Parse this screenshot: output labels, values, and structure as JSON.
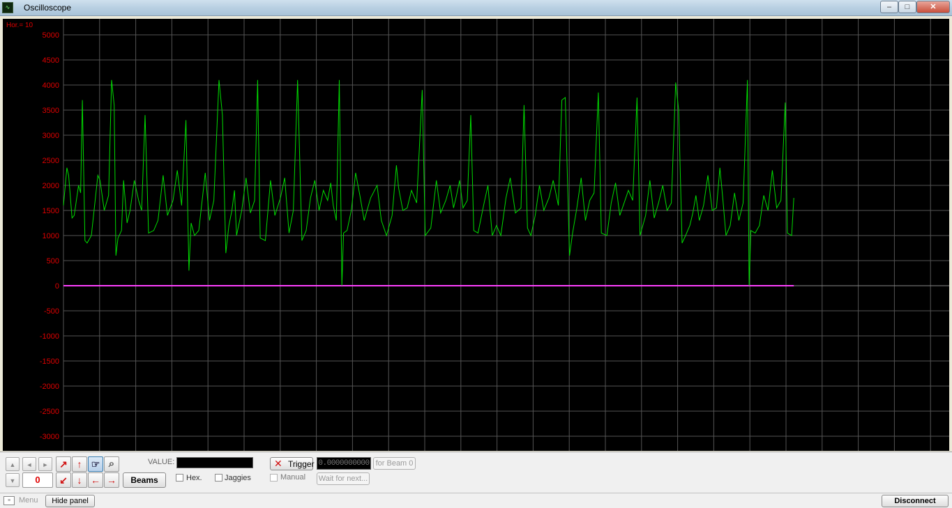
{
  "window": {
    "title": "Oscilloscope",
    "icon": "oscilloscope-app-icon",
    "min_glyph": "–",
    "max_glyph": "□",
    "close_glyph": "✕"
  },
  "scope": {
    "hor_label": "Hor.=  10",
    "background_color": "#000000",
    "grid_color": "#555555",
    "label_color": "#e00000",
    "trace_color": "#00dd00",
    "baseline_color": "#ff40ff"
  },
  "chart_data": {
    "type": "line",
    "title": "",
    "xlabel": "",
    "ylabel": "",
    "ylim": [
      -3000,
      5000
    ],
    "yticks": [
      "5000",
      "4500",
      "4000",
      "3500",
      "3000",
      "2500",
      "2000",
      "1500",
      "1000",
      "500",
      "0",
      "-500",
      "-1000",
      "-1500",
      "-2000",
      "-2500",
      "-3000"
    ],
    "grid": true,
    "x_range": [
      0,
      17
    ],
    "series": [
      {
        "values": [
          [
            0.0,
            1600
          ],
          [
            0.08,
            2350
          ],
          [
            0.12,
            2200
          ],
          [
            0.2,
            1350
          ],
          [
            0.25,
            1400
          ],
          [
            0.35,
            2000
          ],
          [
            0.4,
            1850
          ],
          [
            0.44,
            3700
          ],
          [
            0.5,
            900
          ],
          [
            0.55,
            850
          ],
          [
            0.65,
            1000
          ],
          [
            0.75,
            1800
          ],
          [
            0.8,
            2200
          ],
          [
            0.85,
            2100
          ],
          [
            0.95,
            1500
          ],
          [
            1.05,
            1800
          ],
          [
            1.12,
            4100
          ],
          [
            1.18,
            3600
          ],
          [
            1.22,
            600
          ],
          [
            1.27,
            950
          ],
          [
            1.35,
            1100
          ],
          [
            1.4,
            2100
          ],
          [
            1.48,
            1250
          ],
          [
            1.55,
            1500
          ],
          [
            1.65,
            2100
          ],
          [
            1.75,
            1700
          ],
          [
            1.82,
            1500
          ],
          [
            1.9,
            3400
          ],
          [
            1.98,
            1050
          ],
          [
            2.1,
            1100
          ],
          [
            2.2,
            1300
          ],
          [
            2.32,
            2200
          ],
          [
            2.42,
            1400
          ],
          [
            2.55,
            1700
          ],
          [
            2.65,
            2300
          ],
          [
            2.75,
            1600
          ],
          [
            2.85,
            3300
          ],
          [
            2.92,
            300
          ],
          [
            2.97,
            1250
          ],
          [
            3.05,
            1000
          ],
          [
            3.15,
            1100
          ],
          [
            3.3,
            2250
          ],
          [
            3.4,
            1300
          ],
          [
            3.5,
            1700
          ],
          [
            3.62,
            4100
          ],
          [
            3.7,
            3400
          ],
          [
            3.78,
            650
          ],
          [
            3.85,
            1200
          ],
          [
            3.92,
            1500
          ],
          [
            3.98,
            1900
          ],
          [
            4.03,
            1000
          ],
          [
            4.15,
            1500
          ],
          [
            4.25,
            2150
          ],
          [
            4.35,
            1450
          ],
          [
            4.45,
            1700
          ],
          [
            4.52,
            4100
          ],
          [
            4.58,
            950
          ],
          [
            4.7,
            900
          ],
          [
            4.82,
            2100
          ],
          [
            4.92,
            1400
          ],
          [
            5.05,
            1750
          ],
          [
            5.15,
            2150
          ],
          [
            5.25,
            1050
          ],
          [
            5.35,
            1500
          ],
          [
            5.45,
            4100
          ],
          [
            5.55,
            900
          ],
          [
            5.65,
            1100
          ],
          [
            5.75,
            1750
          ],
          [
            5.85,
            2100
          ],
          [
            5.95,
            1500
          ],
          [
            6.05,
            1900
          ],
          [
            6.15,
            1700
          ],
          [
            6.22,
            2050
          ],
          [
            6.28,
            1600
          ],
          [
            6.35,
            1300
          ],
          [
            6.42,
            4100
          ],
          [
            6.48,
            0
          ],
          [
            6.52,
            1050
          ],
          [
            6.6,
            1100
          ],
          [
            6.7,
            1500
          ],
          [
            6.8,
            2250
          ],
          [
            6.9,
            1800
          ],
          [
            7.0,
            1300
          ],
          [
            7.15,
            1750
          ],
          [
            7.3,
            2000
          ],
          [
            7.4,
            1300
          ],
          [
            7.52,
            1000
          ],
          [
            7.65,
            1400
          ],
          [
            7.75,
            2400
          ],
          [
            7.8,
            1950
          ],
          [
            7.9,
            1500
          ],
          [
            8.0,
            1550
          ],
          [
            8.1,
            1900
          ],
          [
            8.22,
            1650
          ],
          [
            8.35,
            3900
          ],
          [
            8.42,
            1000
          ],
          [
            8.55,
            1150
          ],
          [
            8.68,
            2100
          ],
          [
            8.78,
            1450
          ],
          [
            8.9,
            1700
          ],
          [
            9.0,
            2000
          ],
          [
            9.08,
            1550
          ],
          [
            9.15,
            1800
          ],
          [
            9.22,
            2100
          ],
          [
            9.3,
            1550
          ],
          [
            9.4,
            1700
          ],
          [
            9.48,
            3400
          ],
          [
            9.55,
            1100
          ],
          [
            9.65,
            1050
          ],
          [
            9.78,
            1600
          ],
          [
            9.88,
            2000
          ],
          [
            9.98,
            1000
          ],
          [
            10.08,
            1200
          ],
          [
            10.18,
            1000
          ],
          [
            10.3,
            1750
          ],
          [
            10.4,
            2150
          ],
          [
            10.52,
            1450
          ],
          [
            10.65,
            1550
          ],
          [
            10.72,
            3600
          ],
          [
            10.8,
            1150
          ],
          [
            10.88,
            1000
          ],
          [
            10.98,
            1400
          ],
          [
            11.08,
            2000
          ],
          [
            11.18,
            1500
          ],
          [
            11.3,
            1750
          ],
          [
            11.4,
            2100
          ],
          [
            11.52,
            1600
          ],
          [
            11.6,
            3700
          ],
          [
            11.68,
            3750
          ],
          [
            11.78,
            600
          ],
          [
            11.85,
            1050
          ],
          [
            11.95,
            1550
          ],
          [
            12.05,
            2150
          ],
          [
            12.15,
            1300
          ],
          [
            12.25,
            1700
          ],
          [
            12.35,
            1850
          ],
          [
            12.45,
            3850
          ],
          [
            12.52,
            1050
          ],
          [
            12.65,
            1000
          ],
          [
            12.75,
            1650
          ],
          [
            12.85,
            2050
          ],
          [
            12.95,
            1400
          ],
          [
            13.05,
            1650
          ],
          [
            13.15,
            1900
          ],
          [
            13.25,
            1700
          ],
          [
            13.35,
            3750
          ],
          [
            13.42,
            1000
          ],
          [
            13.55,
            1400
          ],
          [
            13.65,
            2100
          ],
          [
            13.75,
            1350
          ],
          [
            13.85,
            1650
          ],
          [
            13.95,
            2000
          ],
          [
            14.05,
            1500
          ],
          [
            14.15,
            1650
          ],
          [
            14.25,
            4050
          ],
          [
            14.32,
            3500
          ],
          [
            14.4,
            850
          ],
          [
            14.48,
            1000
          ],
          [
            14.58,
            1200
          ],
          [
            14.65,
            1450
          ],
          [
            14.72,
            1800
          ],
          [
            14.8,
            1300
          ],
          [
            14.9,
            1600
          ],
          [
            15.0,
            2200
          ],
          [
            15.1,
            1500
          ],
          [
            15.2,
            1550
          ],
          [
            15.28,
            2350
          ],
          [
            15.35,
            1700
          ],
          [
            15.42,
            1000
          ],
          [
            15.52,
            1200
          ],
          [
            15.62,
            1850
          ],
          [
            15.72,
            1300
          ],
          [
            15.82,
            1650
          ],
          [
            15.92,
            4100
          ],
          [
            15.96,
            0
          ],
          [
            16.0,
            1100
          ],
          [
            16.1,
            1050
          ],
          [
            16.2,
            1200
          ],
          [
            16.3,
            1800
          ],
          [
            16.4,
            1500
          ],
          [
            16.5,
            2300
          ],
          [
            16.6,
            1550
          ],
          [
            16.7,
            1700
          ],
          [
            16.8,
            3650
          ],
          [
            16.85,
            1050
          ],
          [
            16.95,
            1000
          ],
          [
            17.0,
            1750
          ]
        ]
      }
    ]
  },
  "panel": {
    "up_icon": "▲",
    "down_icon": "▼",
    "left_icon": "◄",
    "right_icon": "►",
    "counter": "0",
    "beams_label": "Beams",
    "value_label": "VALUE:",
    "hex_label": "Hex.",
    "jaggies_label": "Jaggies",
    "trigger_label": "Trigger",
    "trigger_icon": "✕",
    "trigger_value": "0.0000000000",
    "for_beam_label": "for Beam 0",
    "manual_label": "Manual",
    "wait_label": "Wait for next...",
    "arrow_upright": "↗",
    "arrow_up": "↑",
    "arrow_downleft": "↙",
    "arrow_down": "↓",
    "arrow_left": "←",
    "arrow_right": "→",
    "hand_icon": "☞",
    "zoom_icon": "⌕"
  },
  "statusbar": {
    "menu_label": "Menu",
    "menu_icon": "≡",
    "hide_panel_label": "Hide panel",
    "disconnect_label": "Disconnect"
  }
}
